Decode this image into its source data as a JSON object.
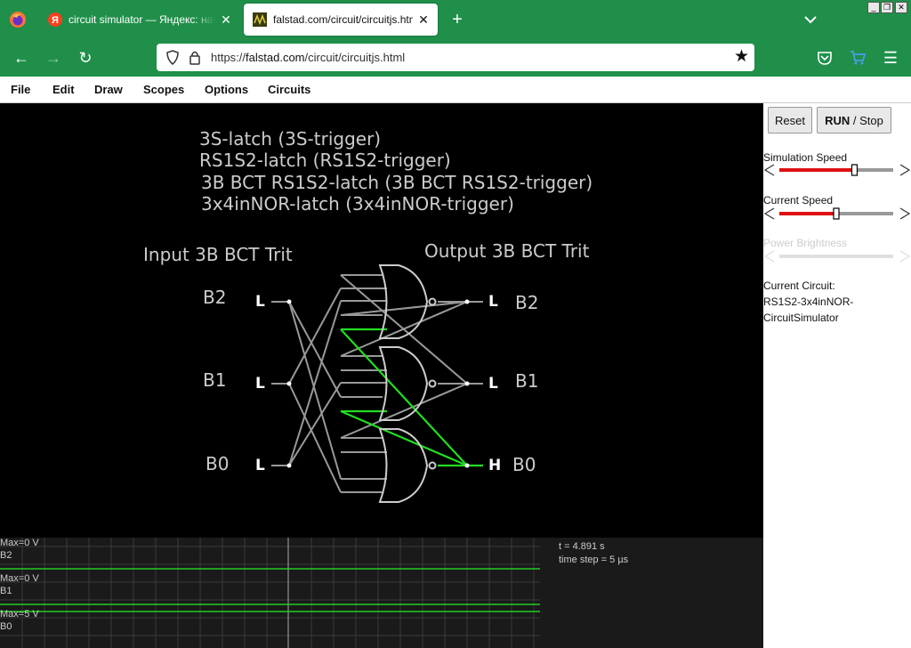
{
  "browser": {
    "tabs": [
      {
        "title": "circuit simulator — Яндекс: нашлось",
        "active": false
      },
      {
        "title": "falstad.com/circuit/circuitjs.html",
        "active": true
      }
    ],
    "url_prefix": "https://",
    "url_host": "falstad.com",
    "url_path": "/circuit/circuitjs.html",
    "accent_color": "#1f8f4a"
  },
  "menu": [
    "File",
    "Edit",
    "Draw",
    "Scopes",
    "Options",
    "Circuits"
  ],
  "circuit": {
    "title_lines": [
      "3S-latch (3S-trigger)",
      "RS1S2-latch (RS1S2-trigger)",
      "3B BCT RS1S2-latch (3B BCT RS1S2-trigger)",
      "3x4inNOR-latch (3x4inNOR-trigger)"
    ],
    "input_heading": "Input 3B BCT Trit",
    "output_heading": "Output 3B BCT Trit",
    "inputs": [
      {
        "name": "B2",
        "state": "L"
      },
      {
        "name": "B1",
        "state": "L"
      },
      {
        "name": "B0",
        "state": "L"
      }
    ],
    "outputs": [
      {
        "name": "B2",
        "state": "L"
      },
      {
        "name": "B1",
        "state": "L"
      },
      {
        "name": "B0",
        "state": "H"
      }
    ],
    "wire_color": "#999999",
    "active_color": "#22dd22"
  },
  "scope": {
    "traces": [
      {
        "max": "Max=0 V",
        "name": "B2"
      },
      {
        "max": "Max=0 V",
        "name": "B1"
      },
      {
        "max": "Max=5 V",
        "name": "B0"
      }
    ],
    "time": "t = 4.891 s",
    "time_step": "time step = 5 µs"
  },
  "side": {
    "reset": "Reset",
    "run_bold": "RUN",
    "run_rest": " / Stop",
    "sim_speed_label": "Simulation Speed",
    "sim_speed_value": 0.66,
    "current_speed_label": "Current Speed",
    "current_speed_value": 0.5,
    "power_label": "Power Brightness",
    "current_circuit_label": "Current Circuit:",
    "current_circuit_name_1": "RS1S2-3x4inNOR-",
    "current_circuit_name_2": "CircuitSimulator"
  }
}
